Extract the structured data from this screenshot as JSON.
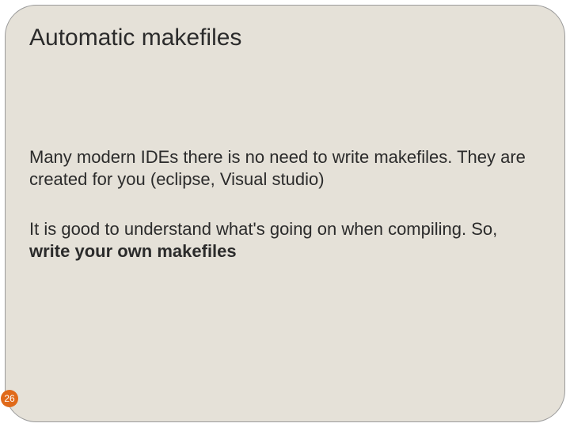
{
  "slide": {
    "title": "Automatic makefiles",
    "para1": "Many modern IDEs there is no need to write makefiles. They are created for you (eclipse, Visual studio)",
    "para2_prefix": "It is good to understand what's going on when compiling. So, ",
    "para2_bold": "write your own makefiles",
    "page_number": "26"
  }
}
